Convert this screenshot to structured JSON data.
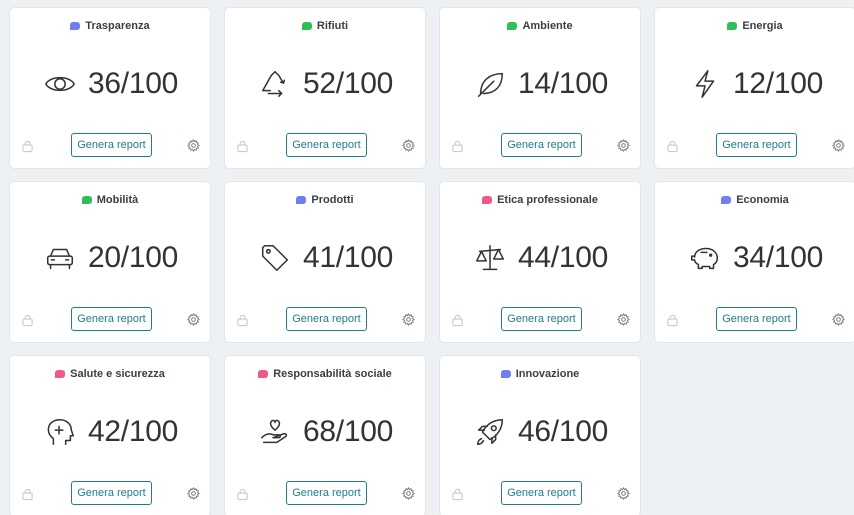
{
  "colors": {
    "blue": "#6f7ff0",
    "green": "#2fbf5a",
    "pink": "#f0578a",
    "accent": "#1f7d8c"
  },
  "cards": [
    {
      "category": "Trasparenza",
      "color": "#6f7ff0",
      "icon": "eye-icon",
      "score": "36/100",
      "button_label": "Genera report"
    },
    {
      "category": "Rifiuti",
      "color": "#2fbf5a",
      "icon": "recycle-icon",
      "score": "52/100",
      "button_label": "Genera report"
    },
    {
      "category": "Ambiente",
      "color": "#2fbf5a",
      "icon": "leaf-icon",
      "score": "14/100",
      "button_label": "Genera report"
    },
    {
      "category": "Energia",
      "color": "#2fbf5a",
      "icon": "lightning-icon",
      "score": "12/100",
      "button_label": "Genera report"
    },
    {
      "category": "Mobilità",
      "color": "#2fbf5a",
      "icon": "car-icon",
      "score": "20/100",
      "button_label": "Genera report"
    },
    {
      "category": "Prodotti",
      "color": "#6f7ff0",
      "icon": "tag-icon",
      "score": "41/100",
      "button_label": "Genera report"
    },
    {
      "category": "Etica professionale",
      "color": "#f0578a",
      "icon": "scale-icon",
      "score": "44/100",
      "button_label": "Genera report"
    },
    {
      "category": "Economia",
      "color": "#6f7ff0",
      "icon": "piggy-bank-icon",
      "score": "34/100",
      "button_label": "Genera report"
    },
    {
      "category": "Salute e sicurezza",
      "color": "#f0578a",
      "icon": "head-health-icon",
      "score": "42/100",
      "button_label": "Genera report"
    },
    {
      "category": "Responsabilità sociale",
      "color": "#f0578a",
      "icon": "hand-heart-icon",
      "score": "68/100",
      "button_label": "Genera report"
    },
    {
      "category": "Innovazione",
      "color": "#6f7ff0",
      "icon": "rocket-icon",
      "score": "46/100",
      "button_label": "Genera report"
    }
  ]
}
